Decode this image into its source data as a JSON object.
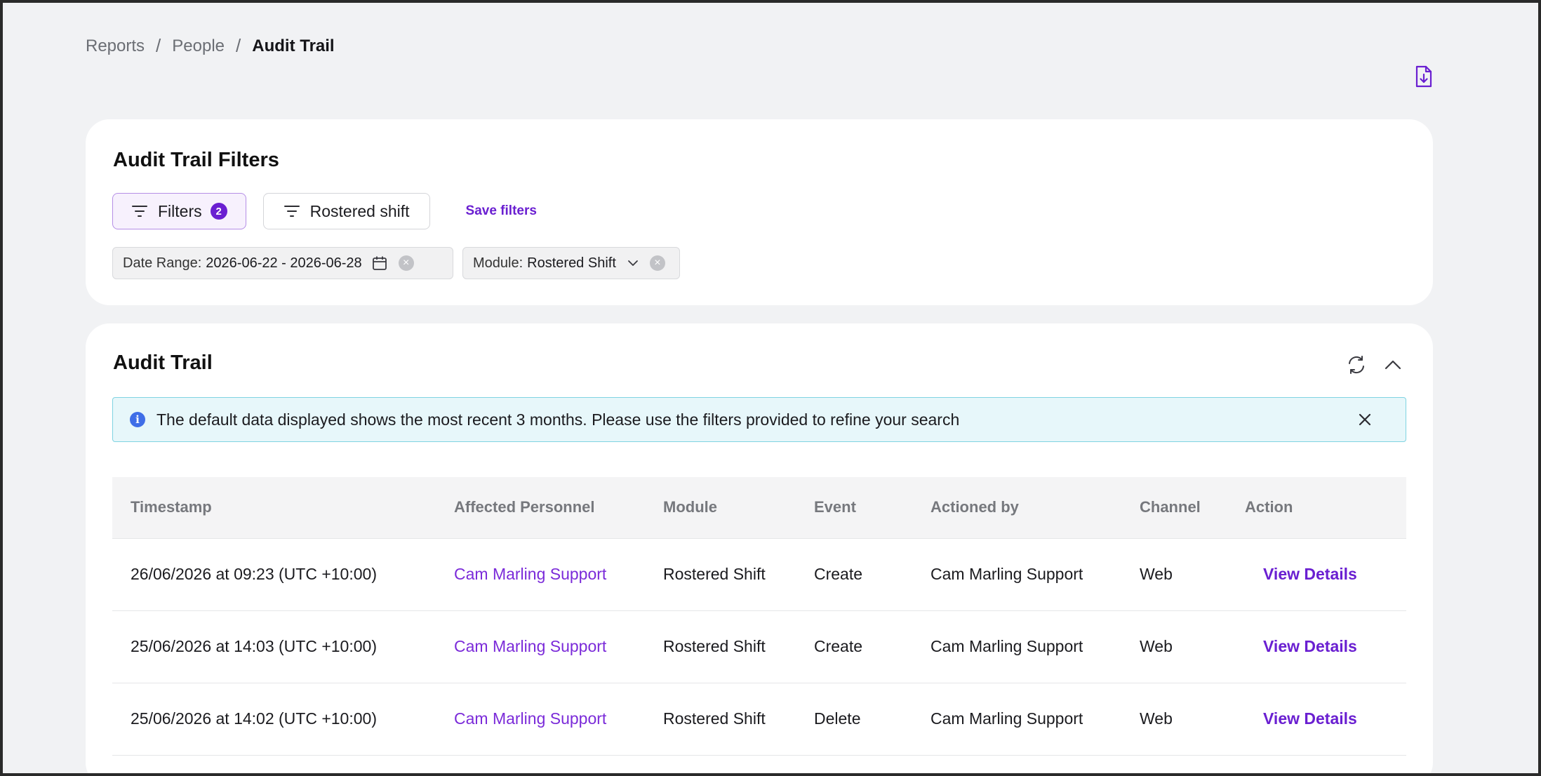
{
  "breadcrumb": {
    "items": [
      "Reports",
      "People"
    ],
    "separator": "/",
    "current": "Audit Trail"
  },
  "header": {
    "export_icon": "file-download-icon"
  },
  "filters_card": {
    "title": "Audit Trail Filters",
    "filters_button": {
      "label": "Filters",
      "count": "2"
    },
    "rostered_button": {
      "label": "Rostered shift"
    },
    "save_link": "Save filters",
    "chips": {
      "date": {
        "label": "Date Range:",
        "value": "2026-06-22 - 2026-06-28"
      },
      "module": {
        "label": "Module:",
        "value": "Rostered Shift"
      }
    }
  },
  "trail_card": {
    "title": "Audit Trail",
    "banner": {
      "text": "The default data displayed shows the most recent 3 months. Please use the filters provided to refine your search",
      "icon": "i"
    },
    "columns": [
      "Timestamp",
      "Affected Personnel",
      "Module",
      "Event",
      "Actioned by",
      "Channel",
      "Action"
    ],
    "rows": [
      {
        "timestamp": "26/06/2026 at 09:23 (UTC +10:00)",
        "personnel": "Cam Marling Support",
        "module": "Rostered Shift",
        "event": "Create",
        "actioned_by": "Cam Marling Support",
        "channel": "Web",
        "action": "View Details"
      },
      {
        "timestamp": "25/06/2026 at 14:03 (UTC +10:00)",
        "personnel": "Cam Marling Support",
        "module": "Rostered Shift",
        "event": "Create",
        "actioned_by": "Cam Marling Support",
        "channel": "Web",
        "action": "View Details"
      },
      {
        "timestamp": "25/06/2026 at 14:02 (UTC +10:00)",
        "personnel": "Cam Marling Support",
        "module": "Rostered Shift",
        "event": "Delete",
        "actioned_by": "Cam Marling Support",
        "channel": "Web",
        "action": "View Details"
      }
    ]
  },
  "colors": {
    "accent": "#6a1fd1",
    "link": "#7b2bd9",
    "banner_bg": "#e7f7fa",
    "banner_border": "#7fd3e2",
    "page_bg": "#f1f2f4"
  }
}
